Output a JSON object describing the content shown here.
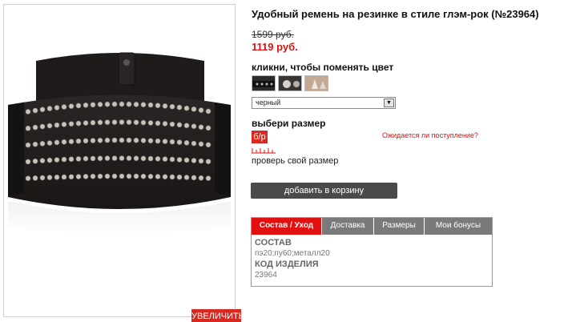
{
  "product": {
    "title": "Удобный ремень на резинке в стиле глэм-рок (№23964)",
    "old_price": "1599 руб.",
    "new_price": "1119 руб."
  },
  "image": {
    "zoom_label": "УВЕЛИЧИТЬ"
  },
  "color": {
    "label": "кликни, чтобы поменять цвет",
    "swatches": [
      "belt-swatch-dark",
      "belt-swatch-studs",
      "belt-swatch-beige"
    ],
    "selected": "черный"
  },
  "size": {
    "label": "выбери размер",
    "option": "б/р",
    "availability_link": "Ожидается ли поступление?",
    "check_link": "проверь свой размер"
  },
  "cart": {
    "button_label": "добавить в корзину"
  },
  "tabs": {
    "items": [
      "Состав / Уход",
      "Доставка",
      "Размеры",
      "Мои бонусы"
    ],
    "active_index": 0,
    "content": {
      "composition_heading": "СОСТАВ",
      "composition_value": "пэ20;пу60;металл20",
      "code_heading": "КОД ИЗДЕЛИЯ",
      "code_value": "23964"
    }
  },
  "colors": {
    "accent_red": "#d8281f",
    "button_dark": "#4a4a4a",
    "tab_inactive": "#7a7a7a"
  }
}
